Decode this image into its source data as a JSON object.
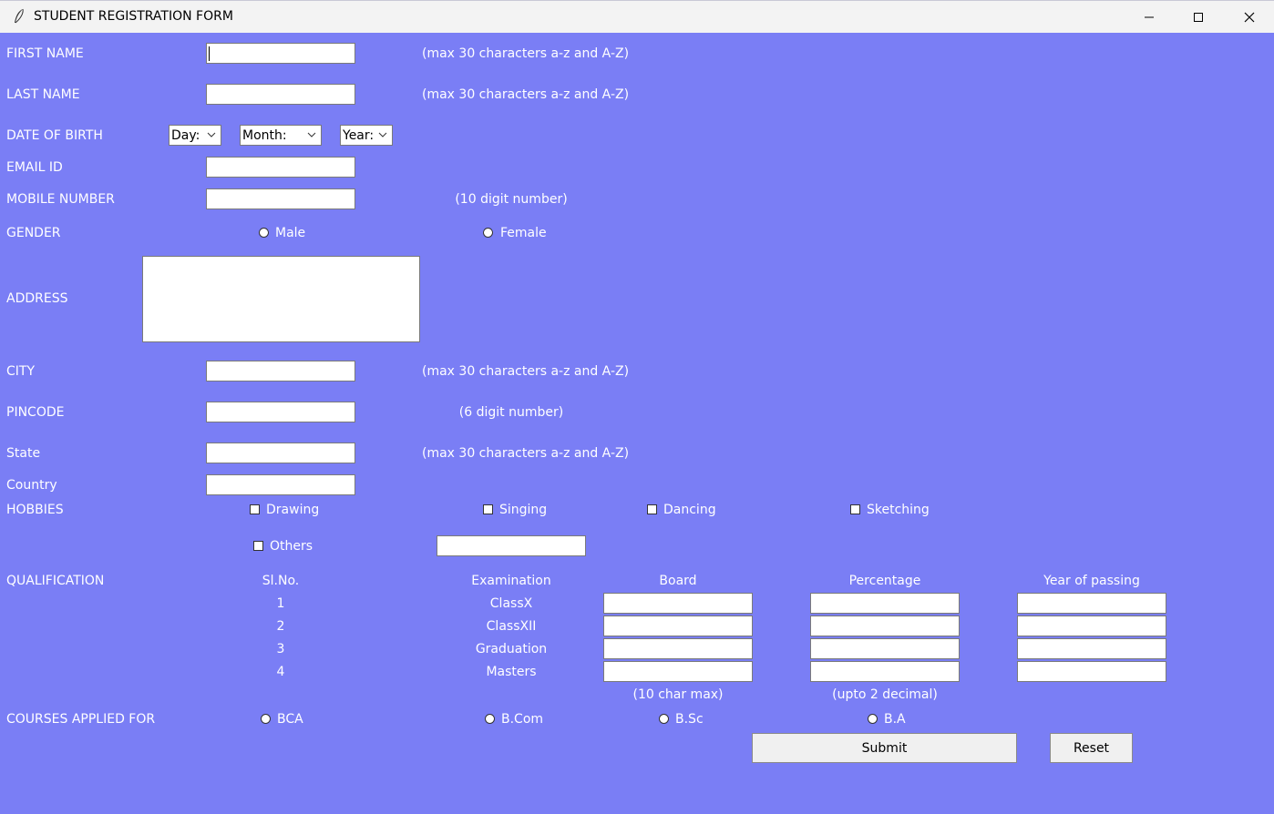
{
  "window": {
    "title": "STUDENT REGISTRATION FORM",
    "icon": "feather-icon",
    "controls": [
      "minimize-icon",
      "maximize-icon",
      "close-icon"
    ]
  },
  "colors": {
    "background": "#7a7ef5",
    "titlebar": "#f3f3f3",
    "label": "#ffffff"
  },
  "form": {
    "first_name": {
      "label": "FIRST NAME",
      "value": "",
      "hint": "(max 30 characters a-z and A-Z)"
    },
    "last_name": {
      "label": "LAST NAME",
      "value": "",
      "hint": "(max 30 characters a-z and A-Z)"
    },
    "dob": {
      "label": "DATE OF BIRTH",
      "day": "Day:",
      "month": "Month:",
      "year": "Year:"
    },
    "email": {
      "label": "EMAIL ID",
      "value": ""
    },
    "mobile": {
      "label": "MOBILE NUMBER",
      "value": "",
      "hint": "(10 digit number)"
    },
    "gender": {
      "label": "GENDER",
      "options": [
        "Male",
        "Female"
      ]
    },
    "address": {
      "label": "ADDRESS",
      "value": ""
    },
    "city": {
      "label": "CITY",
      "value": "",
      "hint": "(max 30 characters a-z and A-Z)"
    },
    "pincode": {
      "label": "PINCODE",
      "value": "",
      "hint": "(6 digit number)"
    },
    "state": {
      "label": "State",
      "value": "",
      "hint": "(max 30 characters a-z and A-Z)"
    },
    "country": {
      "label": "Country",
      "value": ""
    },
    "hobbies": {
      "label": "HOBBIES",
      "options": [
        "Drawing",
        "Singing",
        "Dancing",
        "Sketching",
        "Others"
      ],
      "others_value": ""
    },
    "qualification": {
      "label": "QUALIFICATION",
      "headers": [
        "Sl.No.",
        "Examination",
        "Board",
        "Percentage",
        "Year of passing"
      ],
      "rows": [
        {
          "sno": "1",
          "exam": "ClassX"
        },
        {
          "sno": "2",
          "exam": "ClassXII"
        },
        {
          "sno": "3",
          "exam": "Graduation"
        },
        {
          "sno": "4",
          "exam": "Masters"
        }
      ],
      "board_hint": "(10 char max)",
      "percentage_hint": "(upto 2 decimal)"
    },
    "courses": {
      "label": "COURSES APPLIED FOR",
      "options": [
        "BCA",
        "B.Com",
        "B.Sc",
        "B.A"
      ]
    },
    "buttons": {
      "submit": "Submit",
      "reset": "Reset"
    }
  }
}
